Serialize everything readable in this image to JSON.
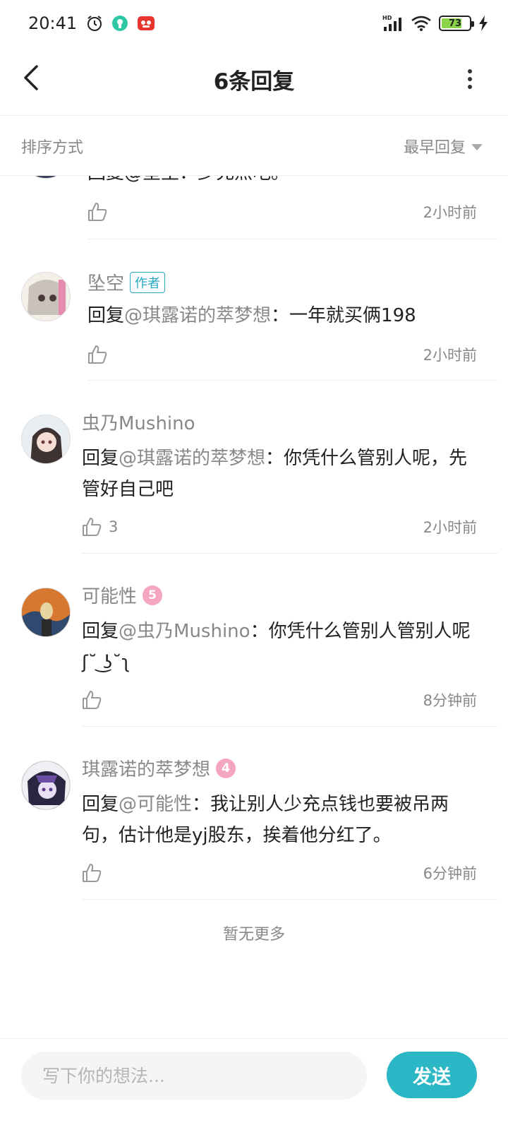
{
  "status_bar": {
    "time": "20:41",
    "battery": "73",
    "battery_level": 0.73,
    "network_label": "HD"
  },
  "header": {
    "title": "6条回复"
  },
  "sort": {
    "label": "排序方式",
    "value": "最早回复"
  },
  "partial_reply": {
    "content": "回复@堂主：少充点吧。",
    "time": "2小时前"
  },
  "replies": [
    {
      "username": "坠空",
      "tag": "作者",
      "reply_prefix": "回复",
      "mention": "@琪露诺的萃梦想",
      "text": "：一年就买俩198",
      "likes": "",
      "time": "2小时前"
    },
    {
      "username": "虫乃Mushino",
      "reply_prefix": "回复",
      "mention": "@琪露诺的萃梦想",
      "text": "：你凭什么管别人呢，先管好自己吧",
      "likes": "3",
      "time": "2小时前"
    },
    {
      "username": "可能性",
      "level": "5",
      "reply_prefix": "回复",
      "mention": "@虫乃Mushino",
      "text": "：你凭什么管别人管别人呢ʃ˘ ͜ʖ˘ʅ",
      "likes": "",
      "time": "8分钟前"
    },
    {
      "username": "琪露诺的萃梦想",
      "level": "4",
      "reply_prefix": "回复",
      "mention": "@可能性",
      "text": "：我让别人少充点钱也要被吊两句，估计他是yj股东，挨着他分红了。",
      "likes": "",
      "time": "6分钟前"
    }
  ],
  "footer": {
    "no_more": "暂无更多"
  },
  "input": {
    "placeholder": "写下你的想法...",
    "send_label": "发送"
  },
  "colors": {
    "accent": "#2bb7c6",
    "author_tag": "#29a9c7",
    "level_badge": "#f6a5c0",
    "muted_text": "#888888"
  }
}
